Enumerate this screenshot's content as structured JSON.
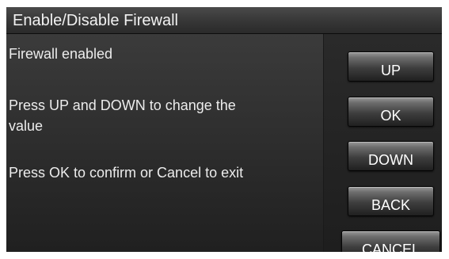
{
  "header": {
    "title": "Enable/Disable Firewall"
  },
  "content": {
    "status": "Firewall enabled",
    "instruction_line_1": "Press UP and DOWN to change the",
    "instruction_line_2": "value",
    "instruction_line_3": "Press OK to confirm or Cancel to exit"
  },
  "buttons": {
    "up": "UP",
    "ok": "OK",
    "down": "DOWN",
    "back": "BACK",
    "cancel": "CANCEL"
  }
}
